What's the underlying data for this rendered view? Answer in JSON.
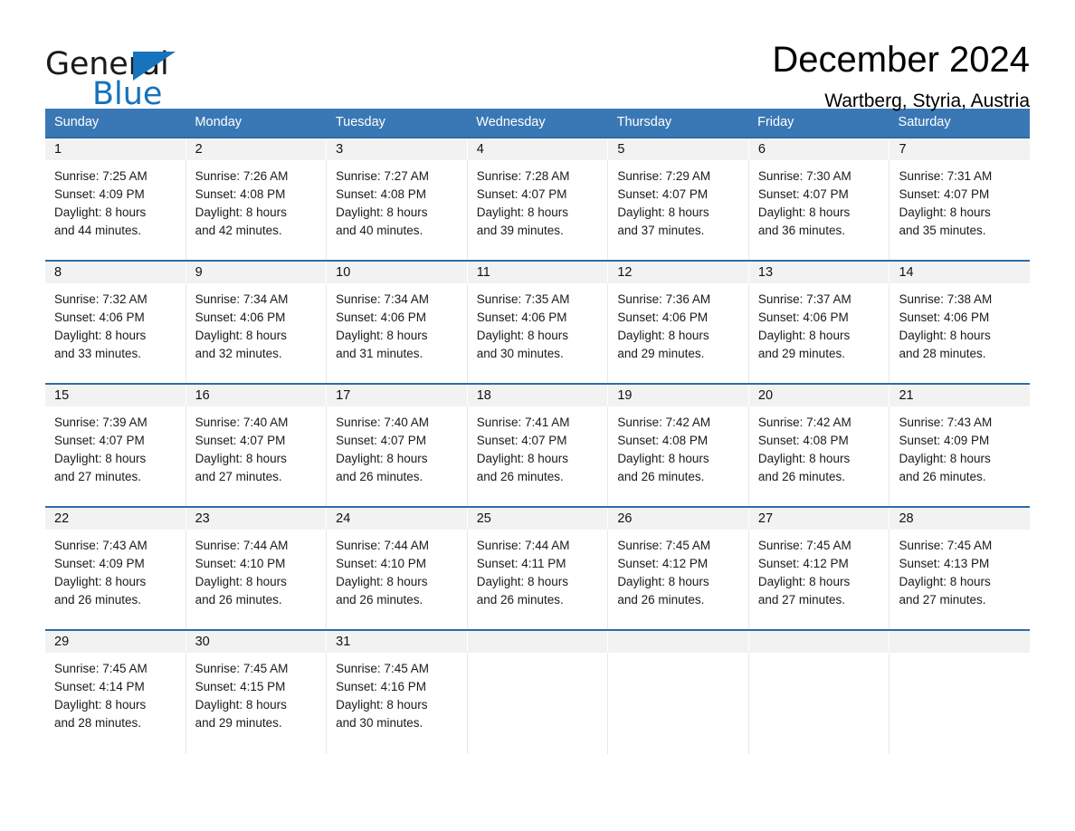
{
  "brand": {
    "logo_text_primary": "General",
    "logo_text_secondary": "Blue",
    "accent_color": "#1673bd"
  },
  "header": {
    "title": "December 2024",
    "subtitle": "Wartberg, Styria, Austria"
  },
  "calendar": {
    "header_bg_color": "#3a78b5",
    "daynum_bg_color": "#f2f2f2",
    "weekdays": [
      "Sunday",
      "Monday",
      "Tuesday",
      "Wednesday",
      "Thursday",
      "Friday",
      "Saturday"
    ],
    "weeks": [
      {
        "days": [
          {
            "day": "1",
            "sunrise": "Sunrise: 7:25 AM",
            "sunset": "Sunset: 4:09 PM",
            "daylight_line1": "Daylight: 8 hours",
            "daylight_line2": "and 44 minutes."
          },
          {
            "day": "2",
            "sunrise": "Sunrise: 7:26 AM",
            "sunset": "Sunset: 4:08 PM",
            "daylight_line1": "Daylight: 8 hours",
            "daylight_line2": "and 42 minutes."
          },
          {
            "day": "3",
            "sunrise": "Sunrise: 7:27 AM",
            "sunset": "Sunset: 4:08 PM",
            "daylight_line1": "Daylight: 8 hours",
            "daylight_line2": "and 40 minutes."
          },
          {
            "day": "4",
            "sunrise": "Sunrise: 7:28 AM",
            "sunset": "Sunset: 4:07 PM",
            "daylight_line1": "Daylight: 8 hours",
            "daylight_line2": "and 39 minutes."
          },
          {
            "day": "5",
            "sunrise": "Sunrise: 7:29 AM",
            "sunset": "Sunset: 4:07 PM",
            "daylight_line1": "Daylight: 8 hours",
            "daylight_line2": "and 37 minutes."
          },
          {
            "day": "6",
            "sunrise": "Sunrise: 7:30 AM",
            "sunset": "Sunset: 4:07 PM",
            "daylight_line1": "Daylight: 8 hours",
            "daylight_line2": "and 36 minutes."
          },
          {
            "day": "7",
            "sunrise": "Sunrise: 7:31 AM",
            "sunset": "Sunset: 4:07 PM",
            "daylight_line1": "Daylight: 8 hours",
            "daylight_line2": "and 35 minutes."
          }
        ]
      },
      {
        "days": [
          {
            "day": "8",
            "sunrise": "Sunrise: 7:32 AM",
            "sunset": "Sunset: 4:06 PM",
            "daylight_line1": "Daylight: 8 hours",
            "daylight_line2": "and 33 minutes."
          },
          {
            "day": "9",
            "sunrise": "Sunrise: 7:34 AM",
            "sunset": "Sunset: 4:06 PM",
            "daylight_line1": "Daylight: 8 hours",
            "daylight_line2": "and 32 minutes."
          },
          {
            "day": "10",
            "sunrise": "Sunrise: 7:34 AM",
            "sunset": "Sunset: 4:06 PM",
            "daylight_line1": "Daylight: 8 hours",
            "daylight_line2": "and 31 minutes."
          },
          {
            "day": "11",
            "sunrise": "Sunrise: 7:35 AM",
            "sunset": "Sunset: 4:06 PM",
            "daylight_line1": "Daylight: 8 hours",
            "daylight_line2": "and 30 minutes."
          },
          {
            "day": "12",
            "sunrise": "Sunrise: 7:36 AM",
            "sunset": "Sunset: 4:06 PM",
            "daylight_line1": "Daylight: 8 hours",
            "daylight_line2": "and 29 minutes."
          },
          {
            "day": "13",
            "sunrise": "Sunrise: 7:37 AM",
            "sunset": "Sunset: 4:06 PM",
            "daylight_line1": "Daylight: 8 hours",
            "daylight_line2": "and 29 minutes."
          },
          {
            "day": "14",
            "sunrise": "Sunrise: 7:38 AM",
            "sunset": "Sunset: 4:06 PM",
            "daylight_line1": "Daylight: 8 hours",
            "daylight_line2": "and 28 minutes."
          }
        ]
      },
      {
        "days": [
          {
            "day": "15",
            "sunrise": "Sunrise: 7:39 AM",
            "sunset": "Sunset: 4:07 PM",
            "daylight_line1": "Daylight: 8 hours",
            "daylight_line2": "and 27 minutes."
          },
          {
            "day": "16",
            "sunrise": "Sunrise: 7:40 AM",
            "sunset": "Sunset: 4:07 PM",
            "daylight_line1": "Daylight: 8 hours",
            "daylight_line2": "and 27 minutes."
          },
          {
            "day": "17",
            "sunrise": "Sunrise: 7:40 AM",
            "sunset": "Sunset: 4:07 PM",
            "daylight_line1": "Daylight: 8 hours",
            "daylight_line2": "and 26 minutes."
          },
          {
            "day": "18",
            "sunrise": "Sunrise: 7:41 AM",
            "sunset": "Sunset: 4:07 PM",
            "daylight_line1": "Daylight: 8 hours",
            "daylight_line2": "and 26 minutes."
          },
          {
            "day": "19",
            "sunrise": "Sunrise: 7:42 AM",
            "sunset": "Sunset: 4:08 PM",
            "daylight_line1": "Daylight: 8 hours",
            "daylight_line2": "and 26 minutes."
          },
          {
            "day": "20",
            "sunrise": "Sunrise: 7:42 AM",
            "sunset": "Sunset: 4:08 PM",
            "daylight_line1": "Daylight: 8 hours",
            "daylight_line2": "and 26 minutes."
          },
          {
            "day": "21",
            "sunrise": "Sunrise: 7:43 AM",
            "sunset": "Sunset: 4:09 PM",
            "daylight_line1": "Daylight: 8 hours",
            "daylight_line2": "and 26 minutes."
          }
        ]
      },
      {
        "days": [
          {
            "day": "22",
            "sunrise": "Sunrise: 7:43 AM",
            "sunset": "Sunset: 4:09 PM",
            "daylight_line1": "Daylight: 8 hours",
            "daylight_line2": "and 26 minutes."
          },
          {
            "day": "23",
            "sunrise": "Sunrise: 7:44 AM",
            "sunset": "Sunset: 4:10 PM",
            "daylight_line1": "Daylight: 8 hours",
            "daylight_line2": "and 26 minutes."
          },
          {
            "day": "24",
            "sunrise": "Sunrise: 7:44 AM",
            "sunset": "Sunset: 4:10 PM",
            "daylight_line1": "Daylight: 8 hours",
            "daylight_line2": "and 26 minutes."
          },
          {
            "day": "25",
            "sunrise": "Sunrise: 7:44 AM",
            "sunset": "Sunset: 4:11 PM",
            "daylight_line1": "Daylight: 8 hours",
            "daylight_line2": "and 26 minutes."
          },
          {
            "day": "26",
            "sunrise": "Sunrise: 7:45 AM",
            "sunset": "Sunset: 4:12 PM",
            "daylight_line1": "Daylight: 8 hours",
            "daylight_line2": "and 26 minutes."
          },
          {
            "day": "27",
            "sunrise": "Sunrise: 7:45 AM",
            "sunset": "Sunset: 4:12 PM",
            "daylight_line1": "Daylight: 8 hours",
            "daylight_line2": "and 27 minutes."
          },
          {
            "day": "28",
            "sunrise": "Sunrise: 7:45 AM",
            "sunset": "Sunset: 4:13 PM",
            "daylight_line1": "Daylight: 8 hours",
            "daylight_line2": "and 27 minutes."
          }
        ]
      },
      {
        "days": [
          {
            "day": "29",
            "sunrise": "Sunrise: 7:45 AM",
            "sunset": "Sunset: 4:14 PM",
            "daylight_line1": "Daylight: 8 hours",
            "daylight_line2": "and 28 minutes."
          },
          {
            "day": "30",
            "sunrise": "Sunrise: 7:45 AM",
            "sunset": "Sunset: 4:15 PM",
            "daylight_line1": "Daylight: 8 hours",
            "daylight_line2": "and 29 minutes."
          },
          {
            "day": "31",
            "sunrise": "Sunrise: 7:45 AM",
            "sunset": "Sunset: 4:16 PM",
            "daylight_line1": "Daylight: 8 hours",
            "daylight_line2": "and 30 minutes."
          },
          {
            "day": "",
            "sunrise": "",
            "sunset": "",
            "daylight_line1": "",
            "daylight_line2": ""
          },
          {
            "day": "",
            "sunrise": "",
            "sunset": "",
            "daylight_line1": "",
            "daylight_line2": ""
          },
          {
            "day": "",
            "sunrise": "",
            "sunset": "",
            "daylight_line1": "",
            "daylight_line2": ""
          },
          {
            "day": "",
            "sunrise": "",
            "sunset": "",
            "daylight_line1": "",
            "daylight_line2": ""
          }
        ]
      }
    ]
  }
}
